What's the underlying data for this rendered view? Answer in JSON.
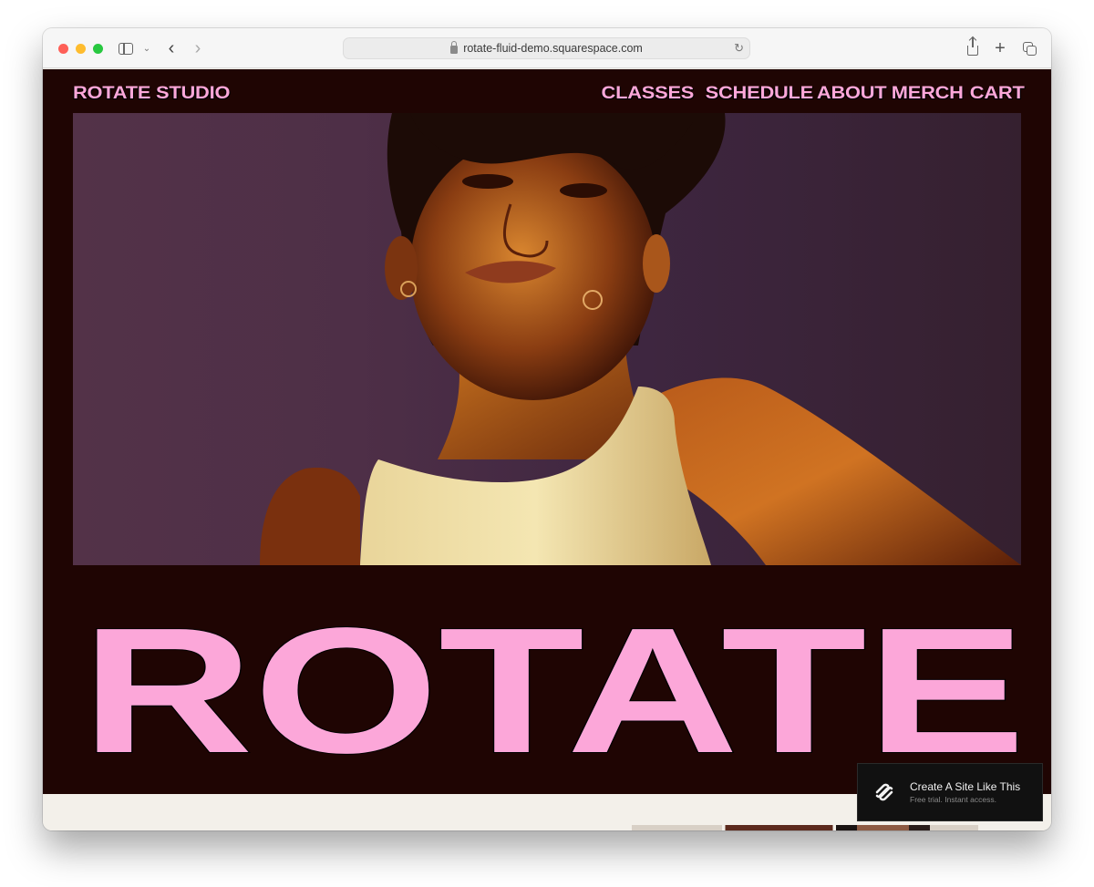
{
  "browser": {
    "url": "rotate-fluid-demo.squarespace.com",
    "traffic_lights": [
      "close",
      "minimize",
      "zoom"
    ],
    "icons": {
      "sidebar": "sidebar-icon",
      "chevron": "⌄",
      "back": "‹",
      "forward": "›",
      "reload": "↻",
      "new_tab": "+"
    }
  },
  "site": {
    "brand": "ROTATE STUDIO",
    "nav": [
      {
        "label": "CLASSES"
      },
      {
        "label": "SCHEDULE"
      },
      {
        "label": "ABOUT"
      },
      {
        "label": "MERCH"
      },
      {
        "label": "CART"
      }
    ],
    "hero_image_alt": "Portrait of a woman in a white ribbed tank top with gold hoop earrings against a purple background, lit by warm orange light",
    "headline": "ROTATE",
    "colors": {
      "background": "#1f0503",
      "accent_pink": "#fca7d9",
      "lower_section": "#f3f0ea"
    }
  },
  "squarespace_badge": {
    "title": "Create A Site Like This",
    "subtitle": "Free trial. Instant access."
  }
}
